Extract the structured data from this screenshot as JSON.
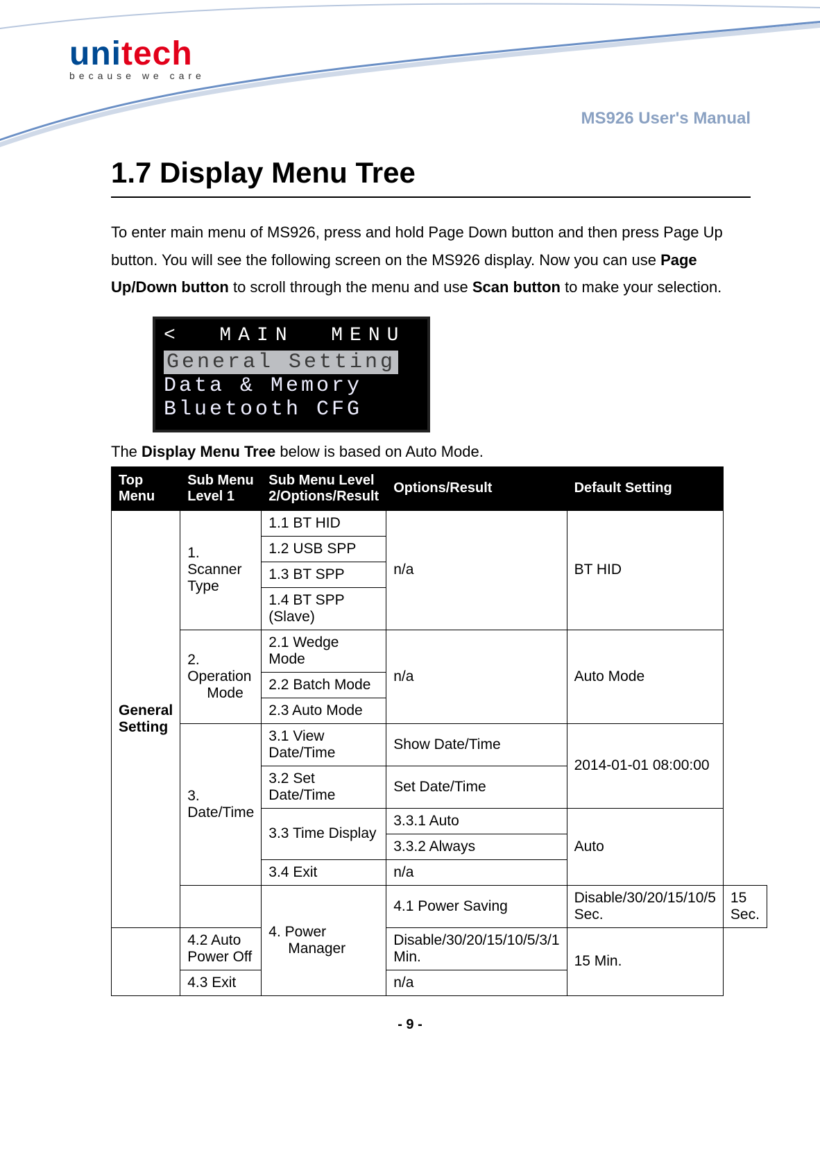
{
  "logo": {
    "brand_uni": "uni",
    "brand_tech": "tech",
    "tagline": "because we care"
  },
  "doc_title": "MS926 User's Manual",
  "section_heading": "1.7 Display Menu Tree",
  "intro": {
    "p1a": "To enter main menu of MS926, press and hold Page Down button and then press Page Up button. You will see the following screen on the MS926 display. Now you can use ",
    "p1b": "Page Up/Down button",
    "p1c": " to scroll through the menu and use ",
    "p1d": "Scan button",
    "p1e": " to make your selection."
  },
  "lcd": {
    "title": "<  MAIN  MENU  >",
    "row1": "General Setting",
    "row2": "Data & Memory",
    "row3": "Bluetooth CFG"
  },
  "caption_a": "The ",
  "caption_b": "Display Menu Tree",
  "caption_c": " below is based on Auto Mode.",
  "table": {
    "headers": {
      "c1": "Top Menu",
      "c2": "Sub Menu Level 1",
      "c3": "Sub Menu Level 2/Options/Result",
      "c4": "Options/Result",
      "c5": "Default Setting"
    },
    "top_menu": "General Setting",
    "g1": {
      "name": "1. Scanner Type",
      "opts": [
        "1.1 BT HID",
        "1.2 USB SPP",
        "1.3 BT SPP",
        "1.4 BT SPP (Slave)"
      ],
      "result": "n/a",
      "default": "BT HID"
    },
    "g2": {
      "name_l1": "2. Operation",
      "name_l2": "Mode",
      "opts": [
        "2.1 Wedge Mode",
        "2.2 Batch Mode",
        "2.3 Auto Mode"
      ],
      "result": "n/a",
      "default": "Auto Mode"
    },
    "g3": {
      "name": "3. Date/Time",
      "r1": {
        "c3": "3.1 View Date/Time",
        "c4": "Show Date/Time"
      },
      "r2": {
        "c3": "3.2 Set Date/Time",
        "c4": "Set Date/Time"
      },
      "default12": "2014-01-01 08:00:00",
      "r3": {
        "c3": "3.3 Time Display",
        "c4a": "3.3.1   Auto",
        "c4b": "3.3.2   Always",
        "default": "Auto"
      },
      "r4": {
        "c3": "3.4 Exit",
        "c4": "n/a"
      }
    },
    "g4": {
      "name_l1": "4. Power",
      "name_l2": "Manager",
      "r1": {
        "c3": "4.1 Power Saving",
        "c4": "Disable/30/20/15/10/5 Sec.",
        "default": "15 Sec."
      },
      "r2": {
        "c3": "4.2 Auto Power Off",
        "c4": "Disable/30/20/15/10/5/3/1 Min.",
        "default": "15 Min."
      },
      "r3": {
        "c3": "4.3 Exit",
        "c4": "n/a"
      }
    }
  },
  "page_number": "- 9 -"
}
